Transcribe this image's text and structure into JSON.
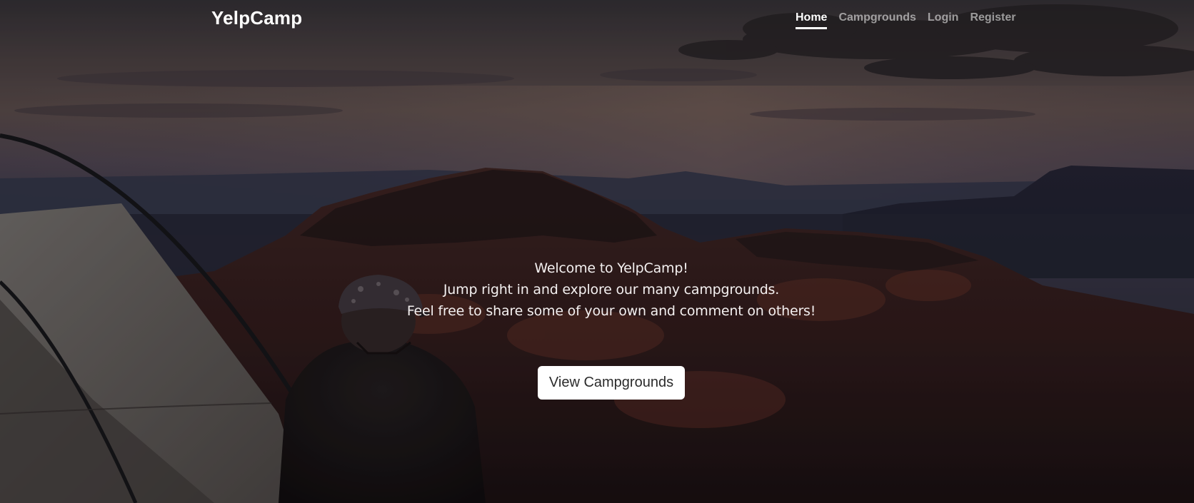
{
  "navbar": {
    "brand": "YelpCamp",
    "links": [
      {
        "label": "Home",
        "active": true
      },
      {
        "label": "Campgrounds",
        "active": false
      },
      {
        "label": "Login",
        "active": false
      },
      {
        "label": "Register",
        "active": false
      }
    ]
  },
  "hero": {
    "line1": "Welcome to YelpCamp!",
    "line2": "Jump right in and explore our many campgrounds.",
    "line3": "Feel free to share some of your own and comment on others!",
    "button_label": "View Campgrounds"
  },
  "colors": {
    "active_link": "#ffffff",
    "inactive_link": "rgba(255,255,255,0.55)",
    "button_bg": "#ffffff",
    "button_text": "#2b2b2b"
  }
}
